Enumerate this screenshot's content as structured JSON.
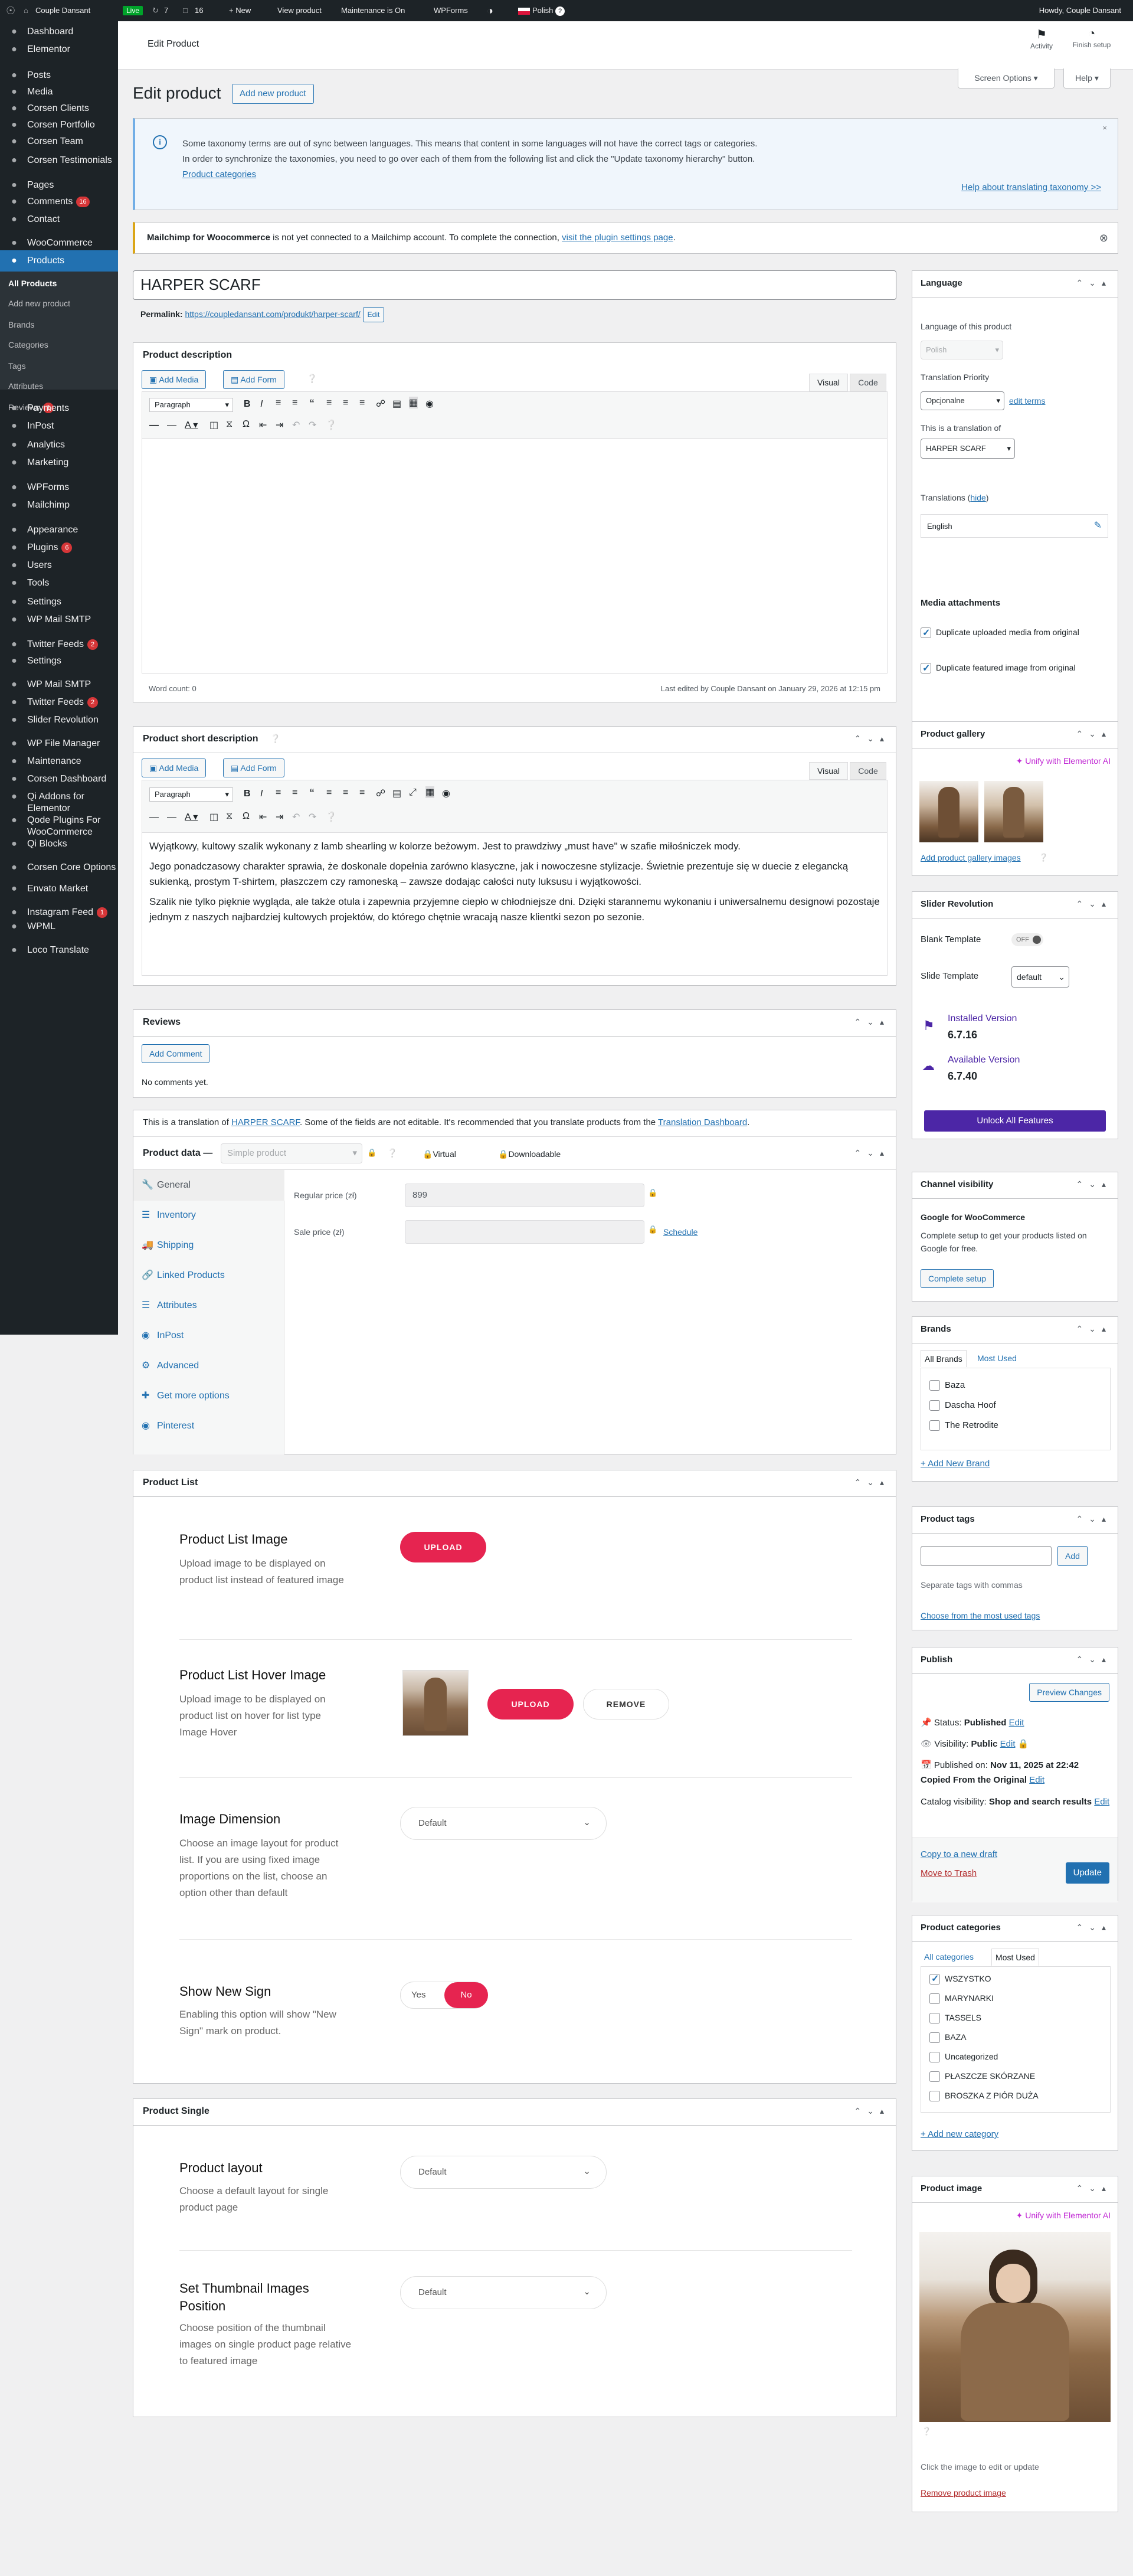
{
  "adminbar": {
    "site": "Couple Dansant",
    "live": "Live",
    "updates": "7",
    "comments": "16",
    "new": "+ New",
    "view": "View product",
    "maintenance": "Maintenance is On",
    "wpforms": "WPForms",
    "lang": "Polish",
    "howdy": "Howdy, Couple Dansant"
  },
  "sidebar": {
    "items": [
      {
        "label": "Dashboard",
        "icon": "dashboard-icon"
      },
      {
        "label": "Elementor",
        "icon": "elementor-icon"
      },
      {
        "label": "Posts",
        "icon": "pin-icon"
      },
      {
        "label": "Media",
        "icon": "media-icon"
      },
      {
        "label": "Corsen Clients",
        "icon": "clients-icon"
      },
      {
        "label": "Corsen Portfolio",
        "icon": "portfolio-icon"
      },
      {
        "label": "Corsen Team",
        "icon": "team-icon"
      },
      {
        "label": "Corsen Testimonials",
        "icon": "testimonials-icon"
      },
      {
        "label": "Pages",
        "icon": "pages-icon"
      },
      {
        "label": "Comments",
        "icon": "comments-icon",
        "badge": "16"
      },
      {
        "label": "Contact",
        "icon": "contact-icon"
      },
      {
        "label": "WooCommerce",
        "icon": "woocommerce-icon"
      },
      {
        "label": "Products",
        "icon": "products-icon"
      },
      {
        "label": "Payments",
        "icon": "payments-icon"
      },
      {
        "label": "InPost",
        "icon": "inpost-icon"
      },
      {
        "label": "Analytics",
        "icon": "analytics-icon"
      },
      {
        "label": "Marketing",
        "icon": "marketing-icon"
      },
      {
        "label": "WPForms",
        "icon": "wpforms-icon"
      },
      {
        "label": "Mailchimp",
        "icon": "mailchimp-icon"
      },
      {
        "label": "Appearance",
        "icon": "appearance-icon"
      },
      {
        "label": "Plugins",
        "icon": "plugins-icon",
        "badge": "6"
      },
      {
        "label": "Users",
        "icon": "users-icon"
      },
      {
        "label": "Tools",
        "icon": "tools-icon"
      },
      {
        "label": "Settings",
        "icon": "settings-icon"
      },
      {
        "label": "WP Mail SMTP",
        "icon": "mail-icon"
      },
      {
        "label": "Twitter Feeds",
        "icon": "twitter-icon",
        "badge": "2"
      },
      {
        "label": "Settings",
        "icon": "settings-icon"
      },
      {
        "label": "WP Mail SMTP",
        "icon": "mail-icon"
      },
      {
        "label": "Twitter Feeds",
        "icon": "twitter-icon",
        "badge": "2"
      },
      {
        "label": "Slider Revolution",
        "icon": "slider-icon"
      },
      {
        "label": "WP File Manager",
        "icon": "file-manager-icon"
      },
      {
        "label": "Maintenance",
        "icon": "maintenance-icon"
      },
      {
        "label": "Corsen Dashboard",
        "icon": "corsen-icon"
      },
      {
        "label": "Qi Addons for Elementor",
        "icon": "qi-icon"
      },
      {
        "label": "Qode Plugins For WooCommerce",
        "icon": "qode-icon"
      },
      {
        "label": "Qi Blocks",
        "icon": "qi-blocks-icon"
      },
      {
        "label": "Corsen Core Options",
        "icon": "core-icon"
      },
      {
        "label": "Envato Market",
        "icon": "envato-icon"
      },
      {
        "label": "Instagram Feed",
        "icon": "instagram-icon",
        "badge": "1"
      },
      {
        "label": "WPML",
        "icon": "wpml-icon"
      },
      {
        "label": "Loco Translate",
        "icon": "loco-icon"
      }
    ],
    "submenu": [
      {
        "label": "All Products"
      },
      {
        "label": "Add new product"
      },
      {
        "label": "Brands"
      },
      {
        "label": "Categories"
      },
      {
        "label": "Tags"
      },
      {
        "label": "Attributes"
      },
      {
        "label": "Reviews",
        "badge": "1"
      }
    ]
  },
  "top": {
    "title": "Edit Product",
    "activity": "Activity",
    "finish": "Finish setup",
    "screen_options": "Screen Options ▾",
    "help": "Help ▾"
  },
  "page": {
    "heading": "Edit product",
    "add_new": "Add new product"
  },
  "notice_taxonomy": {
    "line1": "Some taxonomy terms are out of sync between languages. This means that content in some languages will not have the correct tags or categories.",
    "line2": "In order to synchronize the taxonomies, you need to go over each of them from the following list and click the \"Update taxonomy hierarchy\" button.",
    "link": "Product categories",
    "help": "Help about translating taxonomy >>"
  },
  "notice_mailchimp": {
    "bold": "Mailchimp for Woocommerce",
    "text": " is not yet connected to a Mailchimp account. To complete the connection, ",
    "link": "visit the plugin settings page",
    "end": "."
  },
  "product": {
    "title": "HARPER SCARF",
    "permalink_label": "Permalink:",
    "permalink": "https://coupledansant.com/produkt/harper-scarf/",
    "edit": "Edit"
  },
  "desc": {
    "title": "Product description",
    "add_media": "Add Media",
    "add_form": "Add Form",
    "visual": "Visual",
    "code": "Code",
    "paragraph": "Paragraph",
    "word_count": "Word count: 0",
    "last_edited": "Last edited by Couple Dansant on January 29, 2026 at 12:15 pm"
  },
  "short": {
    "title": "Product short description",
    "add_media": "Add Media",
    "add_form": "Add Form",
    "visual": "Visual",
    "code": "Code",
    "paragraph": "Paragraph",
    "p1": "Wyjątkowy, kultowy szalik wykonany z lamb shearling w kolorze beżowym. Jest to prawdziwy „must have\" w szafie miłośniczek mody.",
    "p2": "Jego ponadczasowy charakter sprawia, że doskonale dopełnia zarówno klasyczne, jak i nowoczesne stylizacje. Świetnie prezentuje się w duecie z elegancką sukienką, prostym T-shirtem, płaszczem czy ramoneską – zawsze dodając całości nuty luksusu i wyjątkowości.",
    "p3": "Szalik nie tylko pięknie wygląda, ale także otula i zapewnia przyjemne ciepło w chłodniejsze dni. Dzięki starannemu wykonaniu i uniwersalnemu designowi pozostaje jednym z naszych najbardziej kultowych projektów, do którego chętnie wracają nasze klientki sezon po sezonie."
  },
  "reviews": {
    "title": "Reviews",
    "add_comment": "Add Comment",
    "none": "No comments yet."
  },
  "translation_notice": {
    "a": "This is a translation of ",
    "link1": "HARPER SCARF",
    "b": ". Some of the fields are not editable. It's recommended that you translate products from the ",
    "link2": "Translation Dashboard",
    "c": "."
  },
  "pdata": {
    "label": "Product data —",
    "type": "Simple product",
    "virtual": "Virtual",
    "downloadable": "Downloadable",
    "tabs": [
      "General",
      "Inventory",
      "Shipping",
      "Linked Products",
      "Attributes",
      "InPost",
      "Advanced",
      "Get more options",
      "Pinterest"
    ],
    "regular_label": "Regular price (zł)",
    "regular_value": "899",
    "sale_label": "Sale price (zł)",
    "schedule": "Schedule"
  },
  "plist": {
    "title": "Product List",
    "img_title": "Product List Image",
    "img_desc": "Upload image to be displayed on product list instead of featured image",
    "upload": "UPLOAD",
    "hover_title": "Product List Hover Image",
    "hover_desc": "Upload image to be displayed on product list on hover for list type Image Hover",
    "remove": "REMOVE",
    "dim_title": "Image Dimension",
    "dim_desc": "Choose an image layout for product list. If you are using fixed image proportions on the list, choose an option other than default",
    "default": "Default",
    "new_title": "Show New Sign",
    "new_desc": "Enabling this option will show \"New Sign\" mark on product.",
    "yes": "Yes",
    "no": "No"
  },
  "psingle": {
    "title": "Product Single",
    "layout_title": "Product layout",
    "layout_desc": "Choose a default layout for single product page",
    "thumb_title": "Set Thumbnail Images Position",
    "thumb_desc": "Choose position of the thumbnail images on single product page relative to featured image",
    "default": "Default"
  },
  "language": {
    "title": "Language",
    "of_product": "Language of this product",
    "lang_value": "Polish",
    "priority_label": "Translation Priority",
    "priority_value": "Opcjonalne",
    "edit_terms": "edit terms",
    "translation_of": "This is a translation of",
    "translation_value": "HARPER SCARF",
    "translations": "Translations",
    "hide": "hide",
    "english": "English",
    "media": "Media attachments",
    "dup1": "Duplicate uploaded media from original",
    "dup2": "Duplicate featured image from original"
  },
  "gallery": {
    "title": "Product gallery",
    "unify": "Unify with Elementor AI",
    "add": "Add product gallery images"
  },
  "slider": {
    "title": "Slider Revolution",
    "blank": "Blank Template",
    "off": "OFF",
    "slide_tpl": "Slide Template",
    "slide_value": "default",
    "installed_label": "Installed Version",
    "installed": "6.7.16",
    "available_label": "Available Version",
    "available": "6.7.40",
    "unlock": "Unlock All Features"
  },
  "channel": {
    "title": "Channel visibility",
    "google": "Google for WooCommerce",
    "desc": "Complete setup to get your products listed on Google for free.",
    "btn": "Complete setup"
  },
  "brands": {
    "title": "Brands",
    "tab_all": "All Brands",
    "tab_used": "Most Used",
    "items": [
      "Baza",
      "Dascha Hoof",
      "The Retrodite"
    ],
    "add": "+ Add New Brand"
  },
  "tags": {
    "title": "Product tags",
    "add": "Add",
    "help": "Separate tags with commas",
    "choose": "Choose from the most used tags"
  },
  "publish": {
    "title": "Publish",
    "preview": "Preview Changes",
    "status_label": "Status:",
    "status": "Published",
    "visibility_label": "Visibility:",
    "visibility": "Public",
    "published_label": "Published on:",
    "published": "Nov 11, 2025 at 22:42",
    "copied": "Copied From the Original",
    "edit": "Edit",
    "catalog_label": "Catalog visibility:",
    "catalog": "Shop and search results",
    "copy_draft": "Copy to a new draft",
    "trash": "Move to Trash",
    "update": "Update"
  },
  "cats": {
    "title": "Product categories",
    "tab_all": "All categories",
    "tab_used": "Most Used",
    "items": [
      {
        "label": "WSZYSTKO",
        "checked": true
      },
      {
        "label": "MARYNARKI",
        "checked": false
      },
      {
        "label": "TASSELS",
        "checked": false
      },
      {
        "label": "BAZA",
        "checked": false
      },
      {
        "label": "Uncategorized",
        "checked": false
      },
      {
        "label": "PŁASZCZE SKÓRZANE",
        "checked": false
      },
      {
        "label": "BROSZKA Z PIÓR DUŻA",
        "checked": false
      }
    ],
    "add": "+ Add new category"
  },
  "pimage": {
    "title": "Product image",
    "unify": "Unify with Elementor AI",
    "help": "Click the image to edit or update",
    "remove": "Remove product image"
  },
  "colors": {
    "admin_dark": "#1d2327",
    "wp_blue": "#2271b1",
    "pink": "#e62450",
    "slider_purple": "#4c26a6"
  }
}
